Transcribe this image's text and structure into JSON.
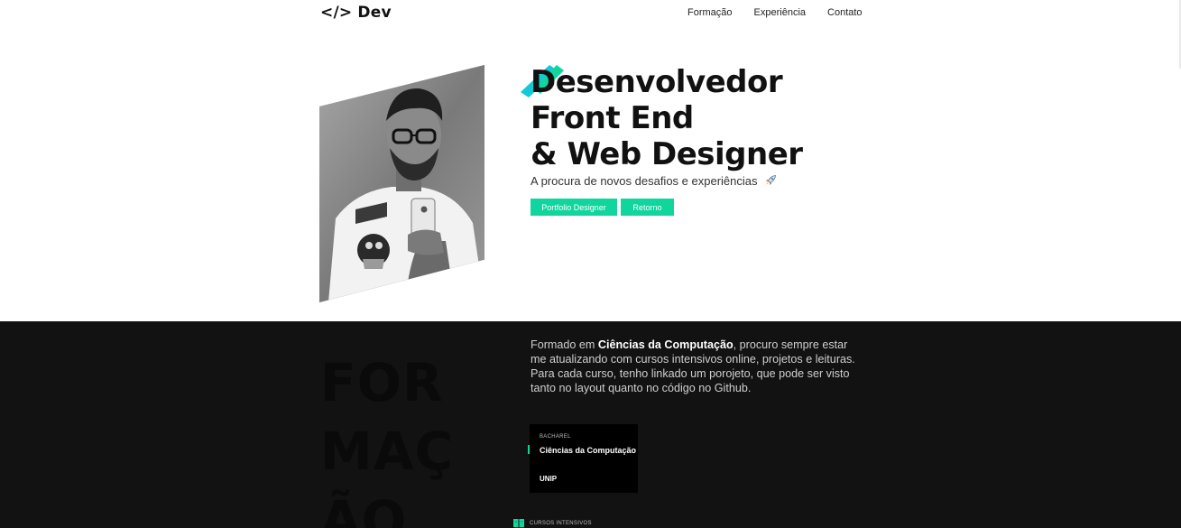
{
  "header": {
    "logo": "</> Dev",
    "nav": [
      "Formação",
      "Experiência",
      "Contato"
    ]
  },
  "hero": {
    "title_lines": [
      "Desenvolvedor",
      "Front End",
      "& Web Designer"
    ],
    "subtitle": "A procura de novos desafios e experiências",
    "subtitle_icon": "rocket-icon",
    "buttons": {
      "portfolio": "Portfolio Designer",
      "retorno": "Retorno"
    },
    "photo": "profile-photo"
  },
  "formacao": {
    "section_word": [
      "FOR",
      "MAÇ",
      "ÃO"
    ],
    "intro_before": "Formado em ",
    "intro_bold": "Ciências da Computação",
    "intro_after": ", procuro sempre estar me atualizando com cursos intensivos online, projetos e leituras. Para cada curso, tenho linkado um porojeto, que pode ser visto tanto no layout quanto no código no Github.",
    "card": {
      "tag": "BACHAREL",
      "title": "Ciências da Computação",
      "institution": "UNIP"
    },
    "intensivos_label": "CURSOS INTENSIVOS",
    "intensivos_icon": "book-icon"
  },
  "colors": {
    "accent": "#10d69e",
    "accent_secondary": "#14c8d8",
    "dark_bg": "#121212",
    "card_bg": "#000000"
  }
}
